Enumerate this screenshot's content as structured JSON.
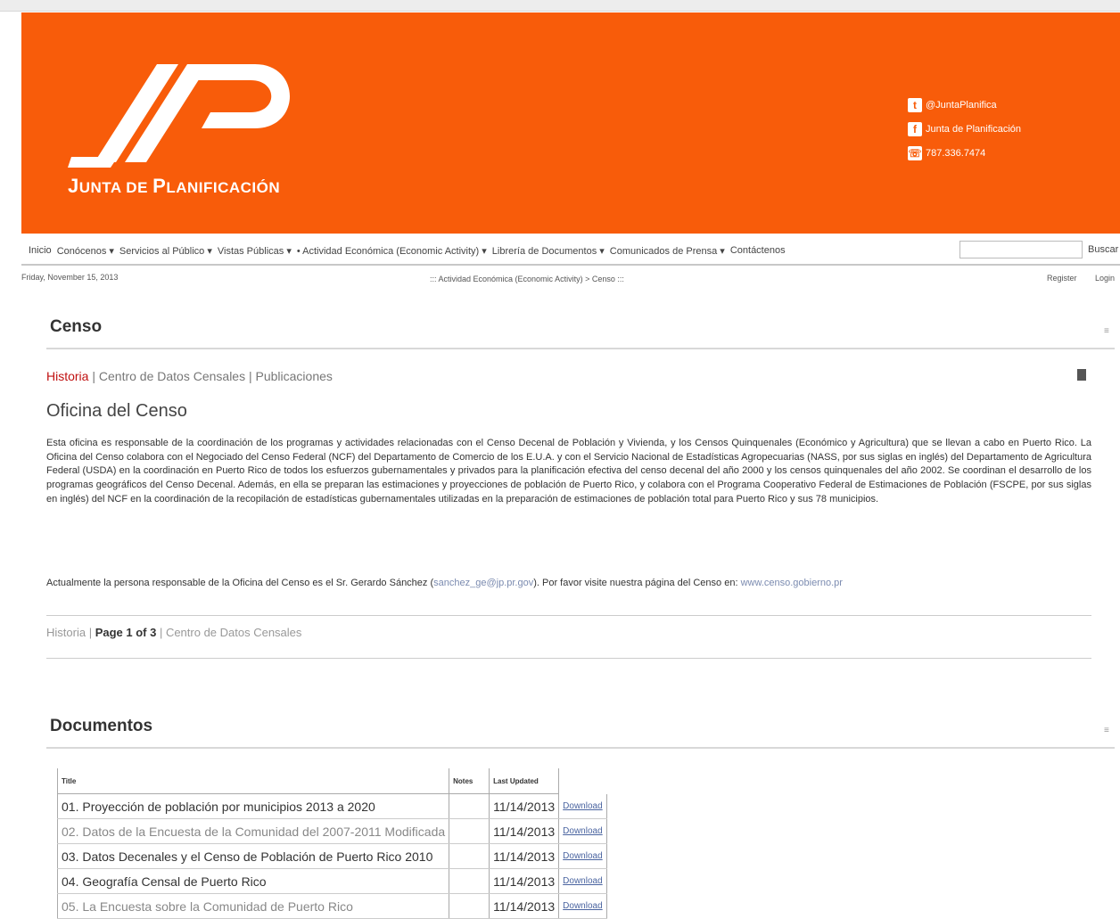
{
  "header": {
    "logo_text_first": "J",
    "logo_text_rest": "UNTA DE ",
    "logo_text_second": "P",
    "logo_text_end": "LANIFICACIÓN",
    "social": [
      {
        "icon": "twitter-icon",
        "glyph": "t",
        "label": "@JuntaPlanifica"
      },
      {
        "icon": "facebook-icon",
        "glyph": "f",
        "label": "Junta de Planificación"
      },
      {
        "icon": "phone-icon",
        "glyph": "☏",
        "label": "787.336.7474"
      }
    ],
    "color": "#f85c0a"
  },
  "nav": {
    "items": [
      "Inicio",
      "Conócenos ▾",
      "Servicios al Público ▾",
      "Vistas Públicas ▾",
      "• Actividad Económica (Economic Activity) ▾",
      "Librería de Documentos ▾",
      "Comunicados de Prensa ▾",
      "Contáctenos"
    ],
    "search_placeholder": "",
    "search_button": "Buscar"
  },
  "subbar": {
    "date": "Friday, November 15, 2013",
    "breadcrumb": "::: Actividad Económica (Economic Activity) > Censo :::",
    "register": "Register",
    "login": "Login"
  },
  "censo": {
    "title": "Censo",
    "collapse": "≡",
    "tabs": {
      "historia": "Historia",
      "sep1": " | ",
      "centro": "Centro de Datos Censales",
      "sep2": "  | ",
      "publicaciones": "Publicaciones"
    },
    "heading": "Oficina del Censo",
    "paragraph": "Esta oficina es responsable de la coordinación de los programas y actividades relacionadas con el Censo Decenal de Población y Vivienda, y los Censos Quinquenales (Económico y Agricultura) que se llevan a cabo en Puerto Rico. La Oficina del Censo colabora con el Negociado del Censo Federal (NCF) del Departamento de Comercio de los E.U.A. y con el Servicio Nacional de Estadísticas Agropecuarias (NASS, por sus siglas en inglés) del Departamento de Agricultura Federal (USDA) en la coordinación en Puerto Rico de todos los esfuerzos gubernamentales y privados para la planificación efectiva del censo decenal del año 2000 y los censos quinquenales del año 2002. Se coordinan el desarrollo de los programas geográficos del Censo Decenal. Además, en ella se preparan las estimaciones y proyecciones de población de Puerto Rico, y colabora con el Programa Cooperativo Federal de Estimaciones de Población (FSCPE, por sus siglas en inglés) del NCF en la coordinación de la recopilación de estadísticas gubernamentales utilizadas en la preparación de estimaciones de población total para Puerto Rico y sus 78 municipios.",
    "contact_prefix": "Actualmente la persona responsable de la Oficina del Censo es el Sr. Gerardo Sánchez (",
    "contact_email": "sanchez_ge@jp.pr.gov",
    "contact_mid": "). Por favor visite nuestra página del Censo en: ",
    "contact_url": "www.censo.gobierno.pr",
    "pager": {
      "prev": "Historia",
      "sep1": " | ",
      "page": "Page 1 of 3",
      "sep2": " | ",
      "next": "Centro de Datos Censales"
    }
  },
  "documentos": {
    "title": "Documentos",
    "collapse": "≡",
    "columns": [
      "Title",
      "Notes",
      "Last Updated",
      ""
    ],
    "rows": [
      {
        "title": "01. Proyección de población por municipios 2013 a 2020",
        "notes": "",
        "updated": "11/14/2013",
        "action": "Download"
      },
      {
        "title": "02. Datos de la Encuesta de la Comunidad del 2007-2011 Modificada",
        "notes": "",
        "updated": "11/14/2013",
        "action": "Download"
      },
      {
        "title": "03. Datos Decenales y el Censo de Población de Puerto Rico 2010",
        "notes": "",
        "updated": "11/14/2013",
        "action": "Download"
      },
      {
        "title": "04. Geografía Censal de Puerto Rico",
        "notes": "",
        "updated": "11/14/2013",
        "action": "Download"
      },
      {
        "title": "05. La Encuesta sobre la Comunidad de Puerto Rico",
        "notes": "",
        "updated": "11/14/2013",
        "action": "Download"
      }
    ]
  }
}
